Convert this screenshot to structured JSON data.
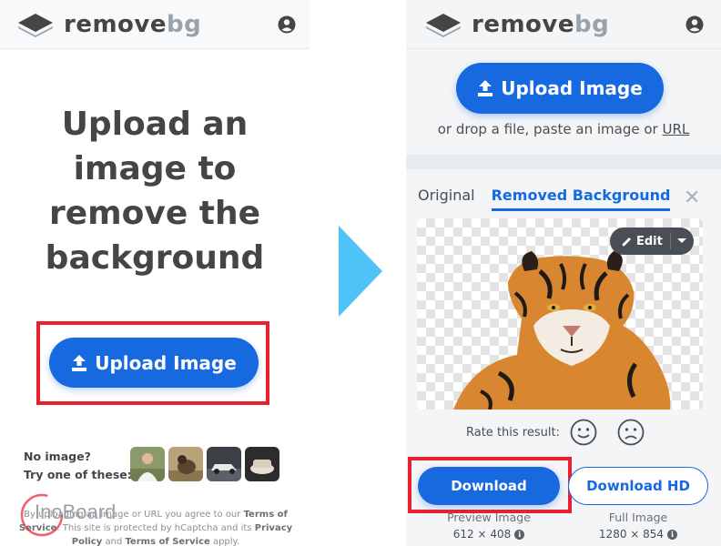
{
  "left_panel": {
    "logo": {
      "part1": "remove",
      "part2": "bg",
      "icon": "layers-icon"
    },
    "user_icon": "user-circle-icon",
    "hero_lines": [
      "Upload an",
      "image to",
      "remove the",
      "background"
    ],
    "upload_button": {
      "label": "Upload Image",
      "icon": "upload-icon"
    },
    "no_image": {
      "line1": "No image?",
      "line2": "Try one of these:"
    },
    "sample_thumbnails": [
      {
        "name": "sample-person"
      },
      {
        "name": "sample-animal"
      },
      {
        "name": "sample-car"
      },
      {
        "name": "sample-object"
      }
    ],
    "legal": {
      "t1": "By uploading an image or URL you agree to our ",
      "terms": "Terms of Service",
      "t2": ". This site is protected by hCaptcha and its ",
      "privacy": "Privacy Policy",
      "t3": " and ",
      "terms2": "Terms of Service",
      "t4": " apply."
    },
    "watermark": "InoBoard"
  },
  "arrow": {
    "color": "#4fc3f7"
  },
  "right_panel": {
    "logo": {
      "part1": "remove",
      "part2": "bg"
    },
    "upload_button": {
      "label": "Upload Image"
    },
    "drop_text": {
      "prefix": "or drop a file, paste an image or ",
      "link": "URL"
    },
    "tabs": [
      {
        "label": "Original",
        "active": false
      },
      {
        "label": "Removed Background",
        "active": true
      }
    ],
    "close_label": "✕",
    "edit_button": {
      "label": "Edit"
    },
    "rate": {
      "label": "Rate this result:"
    },
    "download": {
      "label": "Download",
      "caption": "Preview Image",
      "size": "612 × 408"
    },
    "download_hd": {
      "label": "Download HD",
      "caption": "Full Image",
      "size": "1280 × 854"
    }
  },
  "colors": {
    "accent": "#1769e0",
    "highlight_frame": "#e8202f",
    "arrow": "#4fc3f7",
    "text": "#454545"
  }
}
